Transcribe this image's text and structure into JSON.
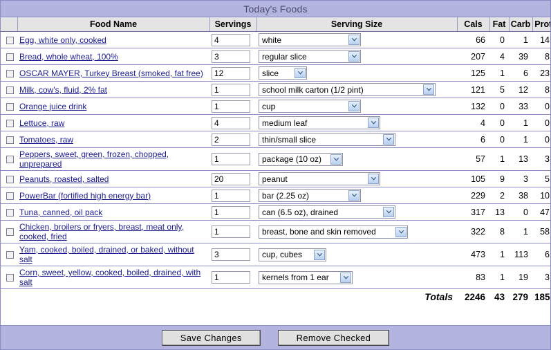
{
  "window": {
    "title": "Today's Foods"
  },
  "table": {
    "headers": {
      "check": "",
      "food_name": "Food Name",
      "servings": "Servings",
      "serving_size": "Serving Size",
      "cals": "Cals",
      "fat": "Fat",
      "carb": "Carb",
      "prot": "Prot"
    },
    "rows": [
      {
        "name": "Egg, white only, cooked",
        "servings": "4",
        "serving_size": "white",
        "size_width": 148,
        "cals": "66",
        "fat": "0",
        "carb": "1",
        "prot": "14",
        "checked": false
      },
      {
        "name": "Bread, whole wheat, 100%",
        "servings": "3",
        "serving_size": "regular slice",
        "size_width": 148,
        "cals": "207",
        "fat": "4",
        "carb": "39",
        "prot": "8",
        "checked": false
      },
      {
        "name": "OSCAR MAYER, Turkey Breast (smoked, fat free)",
        "servings": "12",
        "serving_size": "slice",
        "size_width": 70,
        "cals": "125",
        "fat": "1",
        "carb": "6",
        "prot": "23",
        "checked": false
      },
      {
        "name": "Milk, cow's, fluid, 2% fat",
        "servings": "1",
        "serving_size": "school milk carton (1/2 pint)",
        "size_width": 256,
        "cals": "121",
        "fat": "5",
        "carb": "12",
        "prot": "8",
        "checked": false
      },
      {
        "name": "Orange juice drink",
        "servings": "1",
        "serving_size": "cup",
        "size_width": 148,
        "cals": "132",
        "fat": "0",
        "carb": "33",
        "prot": "0",
        "checked": false
      },
      {
        "name": "Lettuce, raw",
        "servings": "4",
        "serving_size": "medium leaf",
        "size_width": 176,
        "cals": "4",
        "fat": "0",
        "carb": "1",
        "prot": "0",
        "checked": false
      },
      {
        "name": "Tomatoes, raw",
        "servings": "2",
        "serving_size": "thin/small slice",
        "size_width": 198,
        "cals": "6",
        "fat": "0",
        "carb": "1",
        "prot": "0",
        "checked": false
      },
      {
        "name": "Peppers, sweet, green, frozen, chopped, unprepared",
        "servings": "1",
        "serving_size": "package (10 oz)",
        "size_width": 122,
        "cals": "57",
        "fat": "1",
        "carb": "13",
        "prot": "3",
        "checked": false
      },
      {
        "name": "Peanuts, roasted, salted",
        "servings": "20",
        "serving_size": "peanut",
        "size_width": 176,
        "cals": "105",
        "fat": "9",
        "carb": "3",
        "prot": "5",
        "checked": false
      },
      {
        "name": "PowerBar (fortified high energy bar)",
        "servings": "1",
        "serving_size": "bar (2.25 oz)",
        "size_width": 148,
        "cals": "229",
        "fat": "2",
        "carb": "38",
        "prot": "10",
        "checked": false
      },
      {
        "name": "Tuna, canned, oil pack",
        "servings": "1",
        "serving_size": "can (6.5 oz), drained",
        "size_width": 198,
        "cals": "317",
        "fat": "13",
        "carb": "0",
        "prot": "47",
        "checked": false
      },
      {
        "name": "Chicken, broilers or fryers, breast, meat only, cooked, fried",
        "servings": "1",
        "serving_size": "breast, bone and skin removed",
        "size_width": 216,
        "cals": "322",
        "fat": "8",
        "carb": "1",
        "prot": "58",
        "checked": false
      },
      {
        "name": "Yam, cooked, boiled, drained, or baked, without salt",
        "servings": "3",
        "serving_size": "cup, cubes",
        "size_width": 98,
        "cals": "473",
        "fat": "1",
        "carb": "113",
        "prot": "6",
        "checked": false
      },
      {
        "name": "Corn, sweet, yellow, cooked, boiled, drained, with salt",
        "servings": "1",
        "serving_size": "kernels from 1 ear",
        "size_width": 136,
        "cals": "83",
        "fat": "1",
        "carb": "19",
        "prot": "3",
        "checked": false
      }
    ],
    "totals": {
      "label": "Totals",
      "cals": "2246",
      "fat": "43",
      "carb": "279",
      "prot": "185"
    }
  },
  "footer": {
    "save_label": "Save Changes",
    "remove_label": "Remove Checked"
  },
  "colors": {
    "title_bar": "#b4b4e0",
    "header_bg": "#e4e4e4",
    "link": "#1b1b8f",
    "row_border": "#8c8cc4"
  }
}
